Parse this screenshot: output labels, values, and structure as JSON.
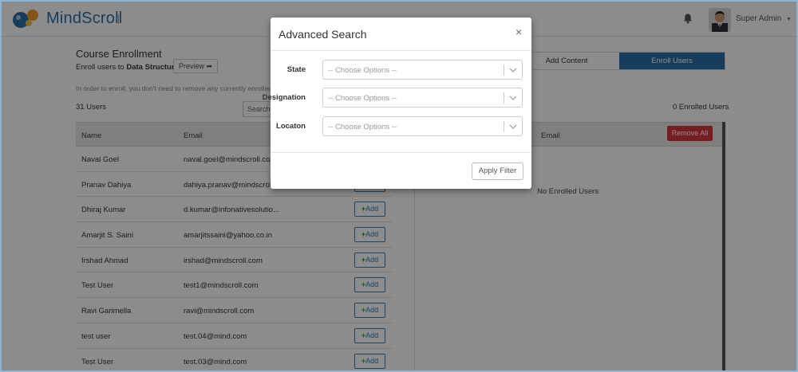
{
  "app": {
    "name": "MindScroll",
    "user_name": "Super Admin"
  },
  "course": {
    "title": "Course Enrollment",
    "subtitle_prefix": "Enroll users to",
    "course_name": "Data Structure",
    "preview_label": "Preview",
    "info": "In order to enroll, you don't need to remove any currently enrolled",
    "users_count": "31 Users",
    "search_placeholder": "Search",
    "columns": {
      "name": "Name",
      "email": "Email"
    },
    "add_label": "Add",
    "users": [
      {
        "name": "Naval Goel",
        "email": "naval.goel@mindscroll.com"
      },
      {
        "name": "Pranav Dahiya",
        "email": "dahiya.pranav@mindscroll."
      },
      {
        "name": "Dhiraj Kumar",
        "email": "d.kumar@infonativesolutio..."
      },
      {
        "name": "Amarjit S. Saini",
        "email": "amarjitssaini@yahoo.co.in"
      },
      {
        "name": "Irshad Ahmad",
        "email": "irshad@mindscroll.com"
      },
      {
        "name": "Test User",
        "email": "test1@mindscroll.com"
      },
      {
        "name": "Ravi Garimella",
        "email": "ravi@mindscroll.com"
      },
      {
        "name": "test user",
        "email": "test.04@mind.com"
      },
      {
        "name": "Test User",
        "email": "test.03@mind.com"
      }
    ]
  },
  "enrolled": {
    "tabs": {
      "add_content": "Add Content",
      "enroll_users": "Enroll Users"
    },
    "count": "0 Enrolled Users",
    "email_column": "Email",
    "remove_all": "Remove All",
    "empty_text": "No Enrolled Users"
  },
  "modal": {
    "title": "Advanced Search",
    "close": "×",
    "fields": [
      {
        "label": "State",
        "placeholder": "-- Choose Options --"
      },
      {
        "label": "Designation",
        "placeholder": "-- Choose Options --"
      },
      {
        "label": "Locaton",
        "placeholder": "-- Choose Options --"
      }
    ],
    "apply_label": "Apply Filter"
  },
  "colors": {
    "brand": "#2a6fa8",
    "danger": "#d9363e",
    "add_green": "#3a9a3a"
  }
}
